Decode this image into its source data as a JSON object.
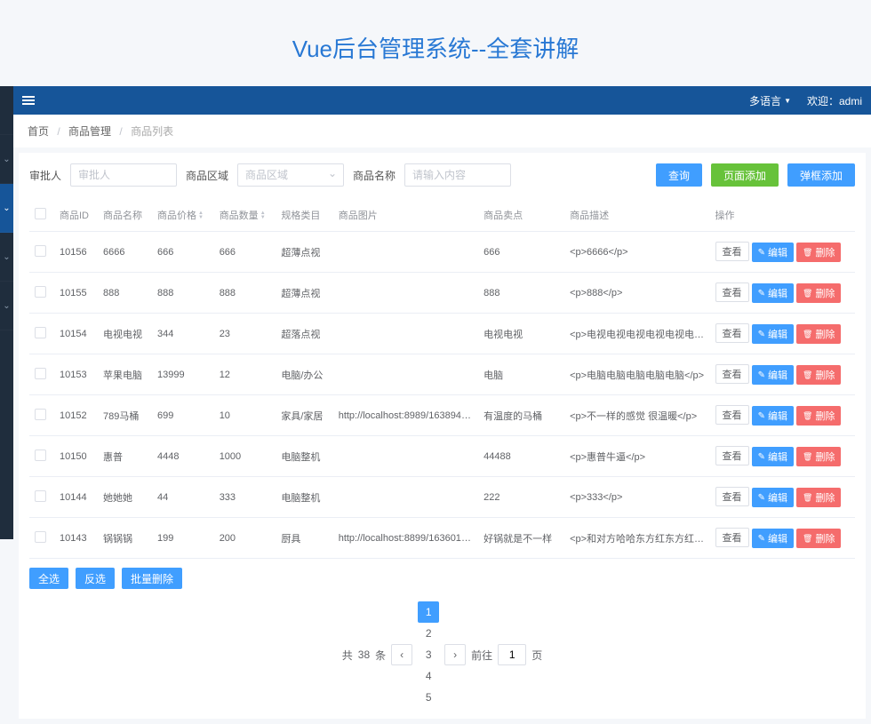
{
  "page_title": "Vue后台管理系统--全套讲解",
  "topbar": {
    "language": "多语言",
    "welcome": "欢迎：admi"
  },
  "breadcrumb": {
    "home": "首页",
    "mgmt": "商品管理",
    "list": "商品列表"
  },
  "filters": {
    "approver_label": "审批人",
    "approver_ph": "审批人",
    "region_label": "商品区域",
    "region_ph": "商品区域",
    "name_label": "商品名称",
    "name_ph": "请输入内容",
    "query": "查询",
    "add_page": "页面添加",
    "add_modal": "弹框添加"
  },
  "columns": {
    "id": "商品ID",
    "name": "商品名称",
    "price": "商品价格",
    "qty": "商品数量",
    "spec": "规格类目",
    "img": "商品图片",
    "selling": "商品卖点",
    "desc": "商品描述",
    "ops": "操作"
  },
  "rows": [
    {
      "id": "10156",
      "name": "6666",
      "price": "666",
      "qty": "666",
      "spec": "超薄点视",
      "img": "",
      "selling": "666",
      "desc": "<p>6666</p>"
    },
    {
      "id": "10155",
      "name": "888",
      "price": "888",
      "qty": "888",
      "spec": "超薄点视",
      "img": "",
      "selling": "888",
      "desc": "<p>888</p>"
    },
    {
      "id": "10154",
      "name": "电视电视",
      "price": "344",
      "qty": "23",
      "spec": "超落点视",
      "img": "",
      "selling": "电视电视",
      "desc": "<p>电视电视电视电视电视电视电视..."
    },
    {
      "id": "10153",
      "name": "苹果电脑",
      "price": "13999",
      "qty": "12",
      "spec": "电脑/办公",
      "img": "",
      "selling": "电脑",
      "desc": "<p>电脑电脑电脑电脑电脑</p>"
    },
    {
      "id": "10152",
      "name": "789马桶",
      "price": "699",
      "qty": "10",
      "spec": "家具/家居",
      "img": "http://localhost:8989/163894728...",
      "selling": "有温度的马桶",
      "desc": "<p>不一样的感觉 很温暖</p>"
    },
    {
      "id": "10150",
      "name": "惠普",
      "price": "4448",
      "qty": "1000",
      "spec": "电脑整机",
      "img": "",
      "selling": "44488",
      "desc": "<p>惠普牛逼</p>"
    },
    {
      "id": "10144",
      "name": "她她她",
      "price": "44",
      "qty": "333",
      "spec": "电脑整机",
      "img": "",
      "selling": "222",
      "desc": "<p>333</p>"
    },
    {
      "id": "10143",
      "name": "锅锅锅",
      "price": "199",
      "qty": "200",
      "spec": "厨具",
      "img": "http://localhost:8899/163601632...",
      "selling": "好锅就是不一样",
      "desc": "<p>和对方哈哈东方红东方红东方红..."
    }
  ],
  "actions": {
    "view": "查看",
    "edit": "编辑",
    "delete": "删除"
  },
  "bulk": {
    "select_all": "全选",
    "invert": "反选",
    "batch_delete": "批量删除"
  },
  "pagination": {
    "total_prefix": "共",
    "total": "38",
    "total_suffix": "条",
    "pages": [
      "1",
      "2",
      "3",
      "4",
      "5"
    ],
    "goto_prefix": "前往",
    "goto_val": "1",
    "goto_suffix": "页"
  }
}
